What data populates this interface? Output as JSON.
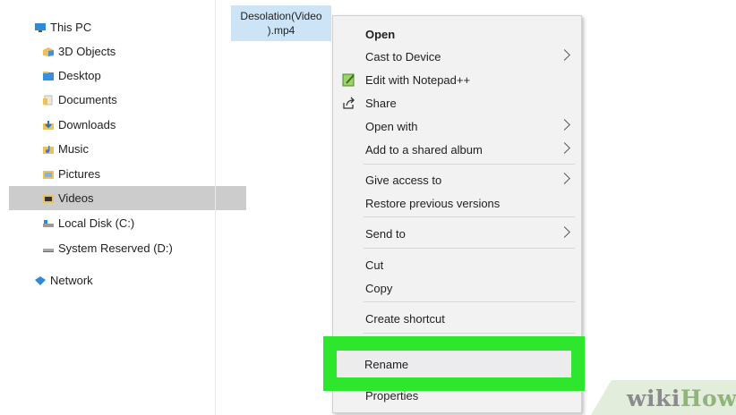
{
  "navigation": {
    "items": [
      {
        "label": "This PC",
        "icon": "this-pc-icon"
      },
      {
        "label": "3D Objects",
        "icon": "3d-objects-icon"
      },
      {
        "label": "Desktop",
        "icon": "desktop-folder-icon"
      },
      {
        "label": "Documents",
        "icon": "documents-folder-icon"
      },
      {
        "label": "Downloads",
        "icon": "downloads-folder-icon"
      },
      {
        "label": "Music",
        "icon": "music-folder-icon"
      },
      {
        "label": "Pictures",
        "icon": "pictures-folder-icon"
      },
      {
        "label": "Videos",
        "icon": "videos-folder-icon"
      },
      {
        "label": "Local Disk (C:)",
        "icon": "local-disk-icon"
      },
      {
        "label": "System Reserved (D:)",
        "icon": "system-reserved-drive-icon"
      },
      {
        "label": "Network",
        "icon": "network-icon"
      }
    ],
    "selected": "Videos"
  },
  "file": {
    "name_line1": "Desolation(Video",
    "name_line2": ").mp4"
  },
  "context_menu": {
    "items": {
      "open": "Open",
      "cast": "Cast to Device",
      "notepad": "Edit with Notepad++",
      "share": "Share",
      "open_with": "Open with",
      "shared_album": "Add to a shared album",
      "give_access": "Give access to",
      "restore": "Restore previous versions",
      "send_to": "Send to",
      "cut": "Cut",
      "copy": "Copy",
      "create_shortcut": "Create shortcut",
      "rename": "Rename",
      "properties": "Properties"
    }
  },
  "watermark": {
    "wiki": "wiki",
    "how": "How"
  },
  "colors": {
    "highlight": "#2ee62e",
    "selection": "#cccccc",
    "file_selection": "#cce4f6",
    "menu_background": "#f2f2f2"
  }
}
